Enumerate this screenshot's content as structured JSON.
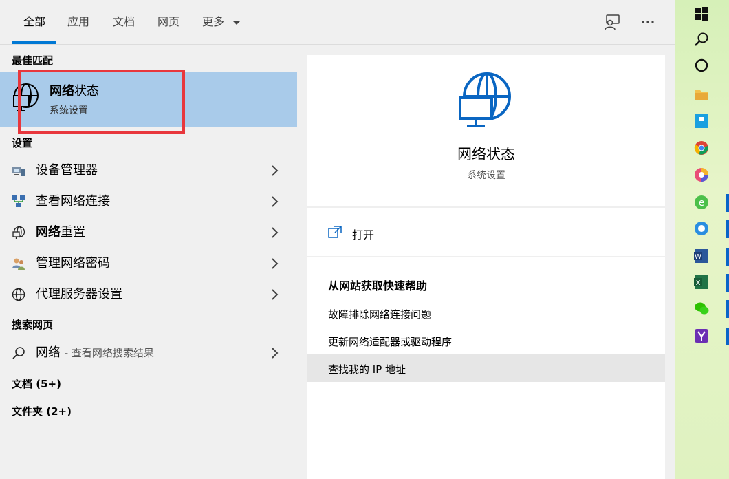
{
  "tabs": [
    {
      "label": "全部",
      "active": true
    },
    {
      "label": "应用"
    },
    {
      "label": "文档"
    },
    {
      "label": "网页"
    },
    {
      "label": "更多"
    }
  ],
  "sections": {
    "best_match": "最佳匹配",
    "settings": "设置",
    "web": "搜索网页",
    "documents": "文档 (5+)",
    "folders": "文件夹 (2+)"
  },
  "best_match": {
    "title_bold": "网络",
    "title_rest": "状态",
    "subtitle": "系统设置"
  },
  "settings_items": [
    {
      "label": "设备管理器",
      "icon": "device-manager-icon"
    },
    {
      "label": "查看网络连接",
      "icon": "network-connections-icon"
    },
    {
      "label_bold": "网络",
      "label_rest": "重置",
      "icon": "globe-monitor-icon"
    },
    {
      "label": "管理网络密码",
      "icon": "users-key-icon"
    },
    {
      "label": "代理服务器设置",
      "icon": "globe-icon"
    }
  ],
  "web_item": {
    "label": "网络",
    "hint": "- 查看网络搜索结果"
  },
  "detail": {
    "title": "网络状态",
    "subtitle": "系统设置",
    "open_label": "打开",
    "help_heading": "从网站获取快速帮助",
    "help_links": [
      "故障排除网络连接问题",
      "更新网络适配器或驱动程序",
      "查找我的 IP 地址"
    ]
  },
  "colors": {
    "accent": "#0078d4",
    "highlight": "#a9cbea",
    "annotation": "#e8373d"
  }
}
